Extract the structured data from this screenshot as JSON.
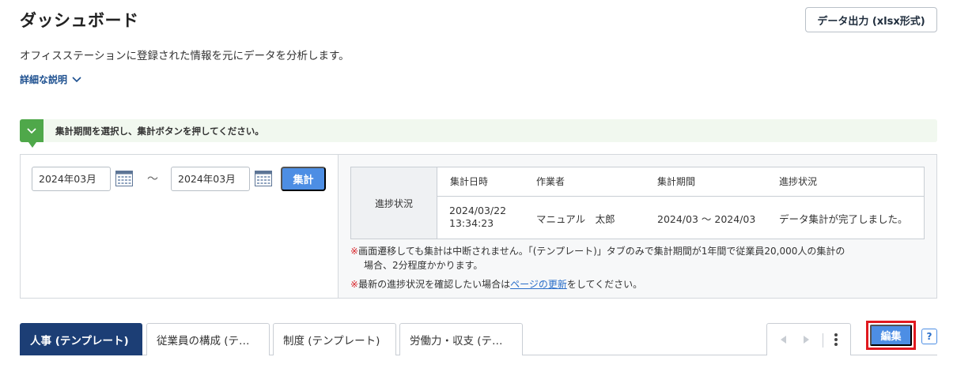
{
  "header": {
    "title": "ダッシュボード",
    "export_label": "データ出力 (xlsx形式)",
    "subtitle": "オフィスステーションに登録された情報を元にデータを分析します。",
    "detail_link": "詳細な説明"
  },
  "hint": {
    "text": "集計期間を選択し、集計ボタンを押してください。"
  },
  "period": {
    "from": "2024年03月",
    "separator": "〜",
    "to": "2024年03月",
    "aggregate_label": "集計"
  },
  "status": {
    "row_header": "進捗状況",
    "columns": [
      "集計日時",
      "作業者",
      "集計期間",
      "進捗状況"
    ],
    "row": {
      "date_line1": "2024/03/22",
      "date_line2": "13:34:23",
      "operator": "マニュアル　太郎",
      "period": "2024/03 ～ 2024/03",
      "progress": "データ集計が完了しました。"
    }
  },
  "notes": {
    "mark": "※",
    "note1_line1": "画面遷移しても集計は中断されません。「(テンプレート)」タブのみで集計期間が1年間で従業員20,000人の集計の",
    "note1_line2": "場合、2分程度かかります。",
    "note2_before": "最新の進捗状況を確認したい場合は",
    "note2_link": "ページの更新",
    "note2_after": "をしてください。"
  },
  "tabs": [
    {
      "label": "人事 (テンプレート)"
    },
    {
      "label": "従業員の構成 (テ…"
    },
    {
      "label": "制度 (テンプレート)"
    },
    {
      "label": "労働力・収支 (テ…"
    }
  ],
  "toolbar": {
    "edit_label": "編集",
    "help_label": "?"
  },
  "colors": {
    "primary": "#4d8ee4",
    "active_tab": "#1c3e75",
    "hint_green": "#4fa84a",
    "highlight_red": "#e0191f"
  }
}
